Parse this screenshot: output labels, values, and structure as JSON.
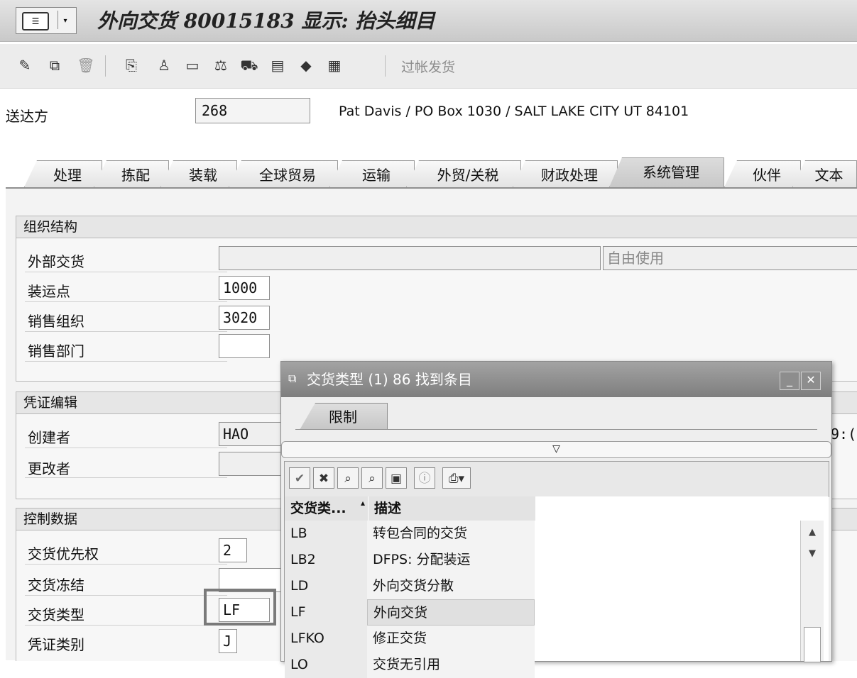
{
  "window": {
    "title": "外向交货 80015183 显示: 抬头细目",
    "menu_icon": "sap-menu-icon"
  },
  "toolbar": {
    "icons": [
      "edit-icon",
      "change-display-icon",
      "delete-icon",
      "document-flow-icon",
      "partner-icon",
      "output-icon",
      "status-icon",
      "header-icon",
      "item-overview-icon",
      "picking-icon",
      "grid-icon"
    ],
    "post_goods_issue": "过帐发货"
  },
  "header": {
    "ship_to_label": "送达方",
    "ship_to_value": "268",
    "ship_to_desc": "Pat Davis / PO Box 1030 / SALT LAKE CITY UT 84101"
  },
  "tabs": [
    "处理",
    "拣配",
    "装载",
    "全球贸易",
    "运输",
    "外贸/关税",
    "财政处理",
    "系统管理",
    "伙伴",
    "文本"
  ],
  "active_tab": "系统管理",
  "groups": {
    "org": {
      "title": "组织结构",
      "ext_delivery_label": "外部交货",
      "ext_delivery_value": "",
      "free_use": "自由使用",
      "shipping_point_label": "装运点",
      "shipping_point_value": "1000",
      "sales_org_label": "销售组织",
      "sales_org_value": "3020",
      "sales_office_label": "销售部门",
      "sales_office_value": ""
    },
    "doc": {
      "title": "凭证编辑",
      "created_by_label": "创建者",
      "created_by_value": "HAO",
      "changed_by_label": "更改者",
      "changed_by_value": "",
      "time_fragment": "9:("
    },
    "control": {
      "title": "控制数据",
      "priority_label": "交货优先权",
      "priority_value": "2",
      "block_label": "交货冻结",
      "block_value": "",
      "type_label": "交货类型",
      "type_value": "LF",
      "category_label": "凭证类别",
      "category_value": "J"
    }
  },
  "popup": {
    "title": "交货类型 (1)   86 找到条目",
    "title_icon": "restrict-icon",
    "tab_label": "限制",
    "collapse_glyph": "▽",
    "tool_icons": [
      "check-icon",
      "cancel-icon",
      "find-icon",
      "find-next-icon",
      "sort-icon",
      "info-icon",
      "print-icon"
    ],
    "columns": [
      "交货类...",
      "描述"
    ],
    "rows": [
      {
        "key": "LB",
        "desc": "转包合同的交货"
      },
      {
        "key": "LB2",
        "desc": "DFPS: 分配装运"
      },
      {
        "key": "LD",
        "desc": "外向交货分散"
      },
      {
        "key": "LF",
        "desc": "外向交货"
      },
      {
        "key": "LFKO",
        "desc": "修正交货"
      },
      {
        "key": "LO",
        "desc": "交货无引用"
      }
    ],
    "selected_row": "LF"
  }
}
